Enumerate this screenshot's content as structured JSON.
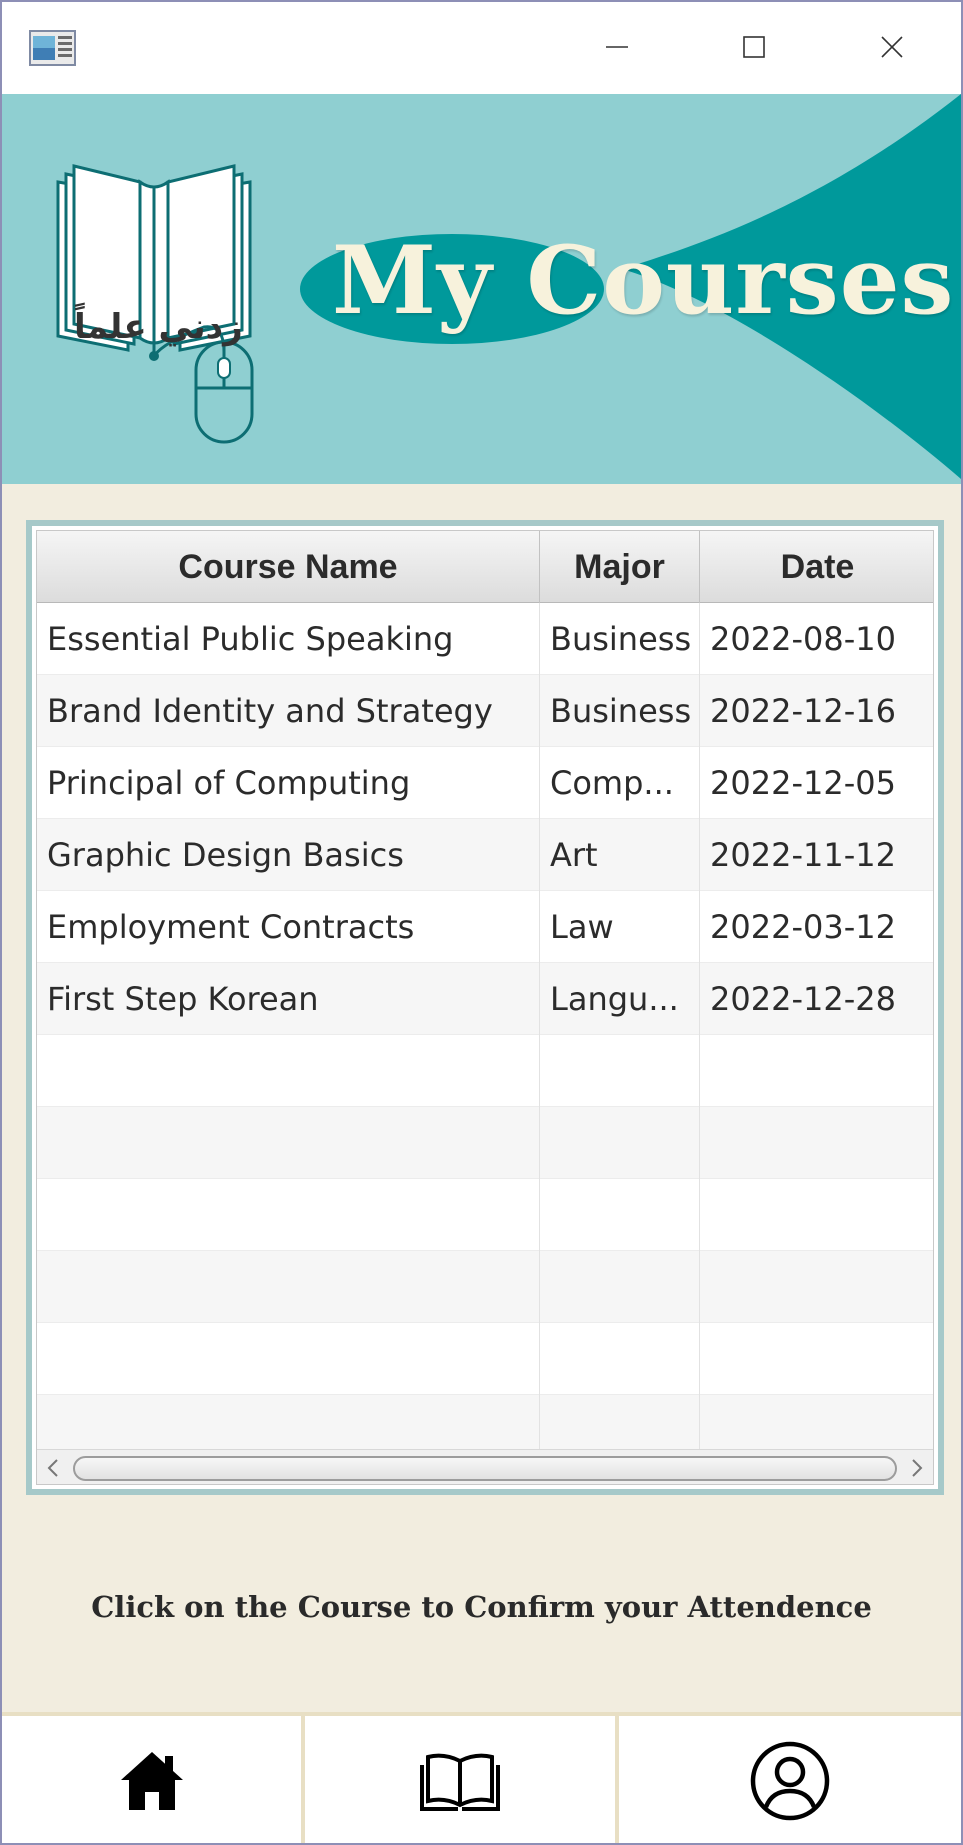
{
  "window": {
    "controls": {
      "minimize": "minimize",
      "maximize": "maximize",
      "close": "close"
    }
  },
  "banner": {
    "title": "My Courses",
    "logo_text": "زدني علماً",
    "colors": {
      "light": "#8fcfd1",
      "dark": "#00999b",
      "title": "#f7f2dc"
    }
  },
  "table": {
    "columns": [
      "Course Name",
      "Major",
      "Date"
    ],
    "rows": [
      [
        "Essential Public Speaking",
        "Business",
        "2022-08-10"
      ],
      [
        "Brand Identity and Strategy",
        "Business",
        "2022-12-16"
      ],
      [
        "Principal of Computing",
        "Comp...",
        "2022-12-05"
      ],
      [
        "Graphic Design Basics",
        "Art",
        "2022-11-12"
      ],
      [
        "Employment Contracts",
        "Law",
        "2022-03-12"
      ],
      [
        "First Step Korean",
        "Langu...",
        "2022-12-28"
      ],
      [
        "",
        "",
        ""
      ],
      [
        "",
        "",
        ""
      ],
      [
        "",
        "",
        ""
      ],
      [
        "",
        "",
        ""
      ],
      [
        "",
        "",
        ""
      ],
      [
        "",
        "",
        ""
      ]
    ]
  },
  "hint": "Click on the Course to Confirm your Attendence",
  "nav": {
    "items": [
      {
        "id": "home",
        "icon": "home-icon"
      },
      {
        "id": "courses",
        "icon": "book-icon"
      },
      {
        "id": "profile",
        "icon": "user-icon"
      }
    ]
  }
}
